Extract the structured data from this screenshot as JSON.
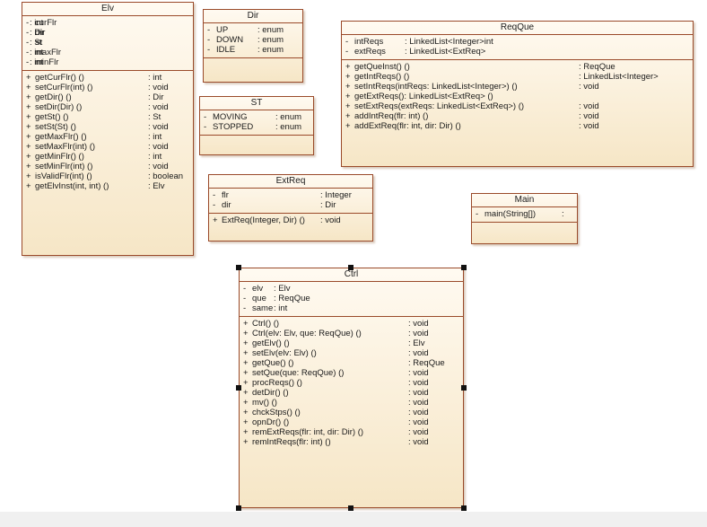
{
  "classes": {
    "elv": {
      "name": "Elv",
      "attributes": [
        {
          "vis": "-",
          "name": "curFlr",
          "type": ": int"
        },
        {
          "vis": "-",
          "name": "dir",
          "type": ": Dir"
        },
        {
          "vis": "-",
          "name": "st",
          "type": ": St"
        },
        {
          "vis": "-",
          "name": "maxFlr",
          "type": ": int"
        },
        {
          "vis": "-",
          "name": "minFlr",
          "type": ": int"
        }
      ],
      "operations": [
        {
          "vis": "+",
          "name": "getCurFlr() ()",
          "type": ": int"
        },
        {
          "vis": "+",
          "name": "setCurFlr(int) ()",
          "type": ": void"
        },
        {
          "vis": "+",
          "name": "getDir() ()",
          "type": ": Dir"
        },
        {
          "vis": "+",
          "name": "setDir(Dir) ()",
          "type": ": void"
        },
        {
          "vis": "+",
          "name": "getSt() ()",
          "type": ": St"
        },
        {
          "vis": "+",
          "name": "setSt(St) ()",
          "type": ": void"
        },
        {
          "vis": "+",
          "name": "getMaxFlr() ()",
          "type": ": int"
        },
        {
          "vis": "+",
          "name": "setMaxFlr(int) ()",
          "type": ": void"
        },
        {
          "vis": "+",
          "name": "getMinFlr() ()",
          "type": ": int"
        },
        {
          "vis": "+",
          "name": "setMinFlr(int) ()",
          "type": ": void"
        },
        {
          "vis": "+",
          "name": "isValidFlr(int) ()",
          "type": ": boolean"
        },
        {
          "vis": "+",
          "name": "getElvInst(int, int) ()",
          "type": ": Elv"
        }
      ]
    },
    "dir": {
      "name": "Dir",
      "attributes": [
        {
          "vis": "-",
          "name": "UP",
          "type": ": enum"
        },
        {
          "vis": "-",
          "name": "DOWN",
          "type": ": enum"
        },
        {
          "vis": "-",
          "name": "IDLE",
          "type": ": enum"
        }
      ],
      "operations": []
    },
    "st": {
      "name": "ST",
      "attributes": [
        {
          "vis": "-",
          "name": "MOVING",
          "type": ": enum"
        },
        {
          "vis": "-",
          "name": "STOPPED",
          "type": ": enum"
        }
      ],
      "operations": []
    },
    "extreq": {
      "name": "ExtReq",
      "attributes": [
        {
          "vis": "-",
          "name": "flr",
          "type": ": Integer"
        },
        {
          "vis": "-",
          "name": "dir",
          "type": ": Dir"
        }
      ],
      "operations": [
        {
          "vis": "+",
          "name": "ExtReq(Integer, Dir) ()",
          "type": ": void"
        }
      ]
    },
    "reqque": {
      "name": "ReqQue",
      "attributes": [
        {
          "vis": "-",
          "name": "intReqs",
          "type": ": LinkedList<Integer>int"
        },
        {
          "vis": "-",
          "name": "extReqs",
          "type": ": LinkedList<ExtReq>"
        }
      ],
      "operations": [
        {
          "vis": "+",
          "name": "getQueInst() ()",
          "type": ": ReqQue"
        },
        {
          "vis": "+",
          "name": "getIntReqs() ()",
          "type": ": LinkedList<Integer>"
        },
        {
          "vis": "+",
          "name": "setIntReqs(intReqs: LinkedList<Integer>) ()",
          "type": ": void"
        },
        {
          "vis": "+",
          "name": "getExtReqs(): LinkedList<ExtReq> ()",
          "type": ""
        },
        {
          "vis": "+",
          "name": "setExtReqs(extReqs: LinkedList<ExtReq>) ()",
          "type": ": void"
        },
        {
          "vis": "+",
          "name": "addIntReq(flr: int) ()",
          "type": ": void"
        },
        {
          "vis": "+",
          "name": "addExtReq(flr: int, dir: Dir) ()",
          "type": ": void"
        }
      ]
    },
    "main": {
      "name": "Main",
      "attributes": [
        {
          "vis": "-",
          "name": "main(String[])",
          "type": ":"
        }
      ],
      "operations": []
    },
    "ctrl": {
      "name": "Ctrl",
      "attributes": [
        {
          "vis": "-",
          "name": "elv",
          "type": ": Elv"
        },
        {
          "vis": "-",
          "name": "que",
          "type": ": ReqQue"
        },
        {
          "vis": "-",
          "name": "same",
          "type": ": int"
        }
      ],
      "operations": [
        {
          "vis": "+",
          "name": "Ctrl() ()",
          "type": ": void"
        },
        {
          "vis": "+",
          "name": "Ctrl(elv: Elv, que: ReqQue) ()",
          "type": ": void"
        },
        {
          "vis": "+",
          "name": "getElv() ()",
          "type": ": Elv"
        },
        {
          "vis": "+",
          "name": "setElv(elv: Elv) ()",
          "type": ": void"
        },
        {
          "vis": "+",
          "name": "getQue() ()",
          "type": ": ReqQue"
        },
        {
          "vis": "+",
          "name": "setQue(que: ReqQue) ()",
          "type": ": void"
        },
        {
          "vis": "+",
          "name": "procReqs() ()",
          "type": ": void"
        },
        {
          "vis": "+",
          "name": "detDir() ()",
          "type": ": void"
        },
        {
          "vis": "+",
          "name": "mv() ()",
          "type": ": void"
        },
        {
          "vis": "+",
          "name": "chckStps() ()",
          "type": ": void"
        },
        {
          "vis": "+",
          "name": "opnDr() ()",
          "type": ": void"
        },
        {
          "vis": "+",
          "name": "remExtReqs(flr: int, dir: Dir) ()",
          "type": ": void"
        },
        {
          "vis": "+",
          "name": "remIntReqs(flr: int) ()",
          "type": ": void"
        }
      ]
    }
  }
}
